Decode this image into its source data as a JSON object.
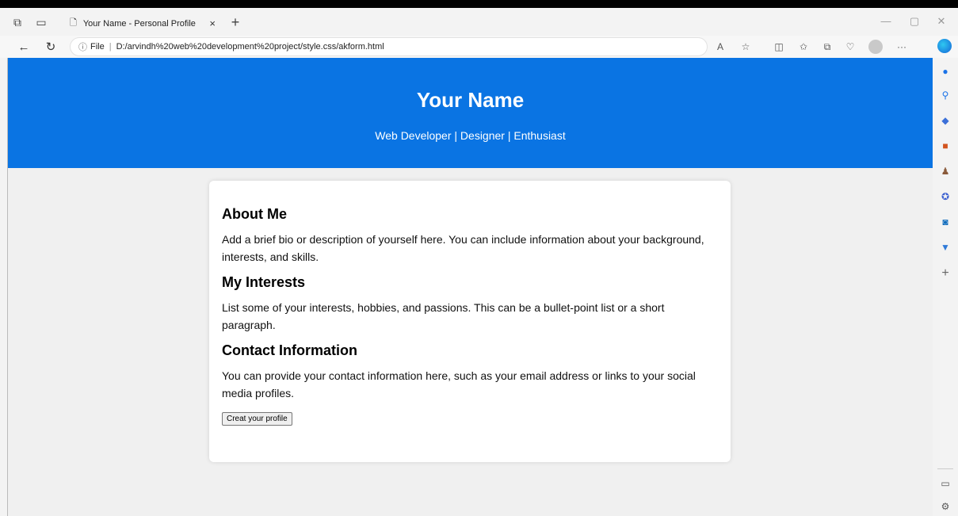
{
  "browser": {
    "tab_title": "Your Name - Personal Profile",
    "tab_close": "×",
    "new_tab": "+",
    "address_info": "File",
    "address_url": "D:/arvindh%20web%20development%20project/style.css/akform.html",
    "window_controls": [
      "—",
      "▢",
      "✕"
    ]
  },
  "header": {
    "name": "Your Name",
    "tagline": "Web Developer | Designer | Enthusiast",
    "bg_color": "#0a74e3"
  },
  "sections": [
    {
      "heading": "About Me",
      "body": "Add a brief bio or description of yourself here. You can include information about your background, interests, and skills."
    },
    {
      "heading": "My Interests",
      "body": "List some of your interests, hobbies, and passions. This can be a bullet-point list or a short paragraph."
    },
    {
      "heading": "Contact Information",
      "body": "You can provide your contact information here, such as your email address or links to your social media profiles."
    }
  ],
  "button": {
    "label": "Creat your profile"
  },
  "icons": {
    "back": "back-arrow-icon",
    "refresh": "refresh-icon",
    "info": "info-icon"
  }
}
